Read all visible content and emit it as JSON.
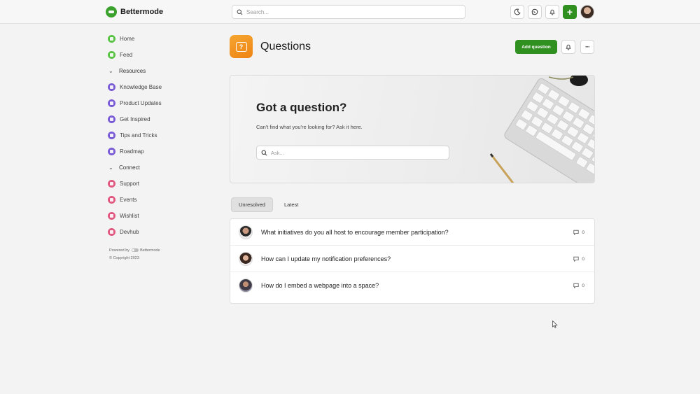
{
  "brand": {
    "name": "Bettermode",
    "color": "#3aa12c"
  },
  "search": {
    "placeholder": "Search..."
  },
  "top_actions": {
    "theme_icon": "moon-icon",
    "chat_icon": "whatsapp-icon",
    "notifications_icon": "bell-icon",
    "create_icon": "plus-icon"
  },
  "sidebar": {
    "items": [
      {
        "label": "Home",
        "icon": "home-icon",
        "color": "#58c243"
      },
      {
        "label": "Feed",
        "icon": "feed-icon",
        "color": "#58c243"
      }
    ],
    "groups": [
      {
        "label": "Resources",
        "items": [
          {
            "label": "Knowledge Base",
            "icon": "knowledge-base-icon",
            "color": "#7a5bd6"
          },
          {
            "label": "Product Updates",
            "icon": "product-updates-icon",
            "color": "#7a5bd6"
          },
          {
            "label": "Get Inspired",
            "icon": "get-inspired-icon",
            "color": "#7a5bd6"
          },
          {
            "label": "Tips and Tricks",
            "icon": "tips-icon",
            "color": "#7a5bd6"
          },
          {
            "label": "Roadmap",
            "icon": "roadmap-icon",
            "color": "#7a5bd6"
          }
        ]
      },
      {
        "label": "Connect",
        "items": [
          {
            "label": "Support",
            "icon": "support-icon",
            "color": "#e0577f"
          },
          {
            "label": "Events",
            "icon": "events-icon",
            "color": "#e0577f"
          },
          {
            "label": "Wishlist",
            "icon": "wishlist-icon",
            "color": "#e0577f"
          },
          {
            "label": "Devhub",
            "icon": "devhub-icon",
            "color": "#e0577f"
          }
        ]
      }
    ],
    "powered_by_prefix": "Powered by",
    "powered_by_brand": "Bettermode",
    "copyright": "© Copyright 2023"
  },
  "page": {
    "title": "Questions",
    "icon": "question-bubble-icon",
    "add_button": "Add question",
    "accent": "#2f8f1f"
  },
  "hero": {
    "title": "Got a question?",
    "subtitle": "Can't find what you're looking for? Ask it here.",
    "search_placeholder": "Ask..."
  },
  "tabs": [
    {
      "label": "Unresolved",
      "active": true
    },
    {
      "label": "Latest",
      "active": false
    }
  ],
  "questions": [
    {
      "title": "What initiatives do you all host to encourage member participation?",
      "comments": "0"
    },
    {
      "title": "How can I update my notification preferences?",
      "comments": "0"
    },
    {
      "title": "How do I embed a webpage into a space?",
      "comments": "0"
    }
  ]
}
